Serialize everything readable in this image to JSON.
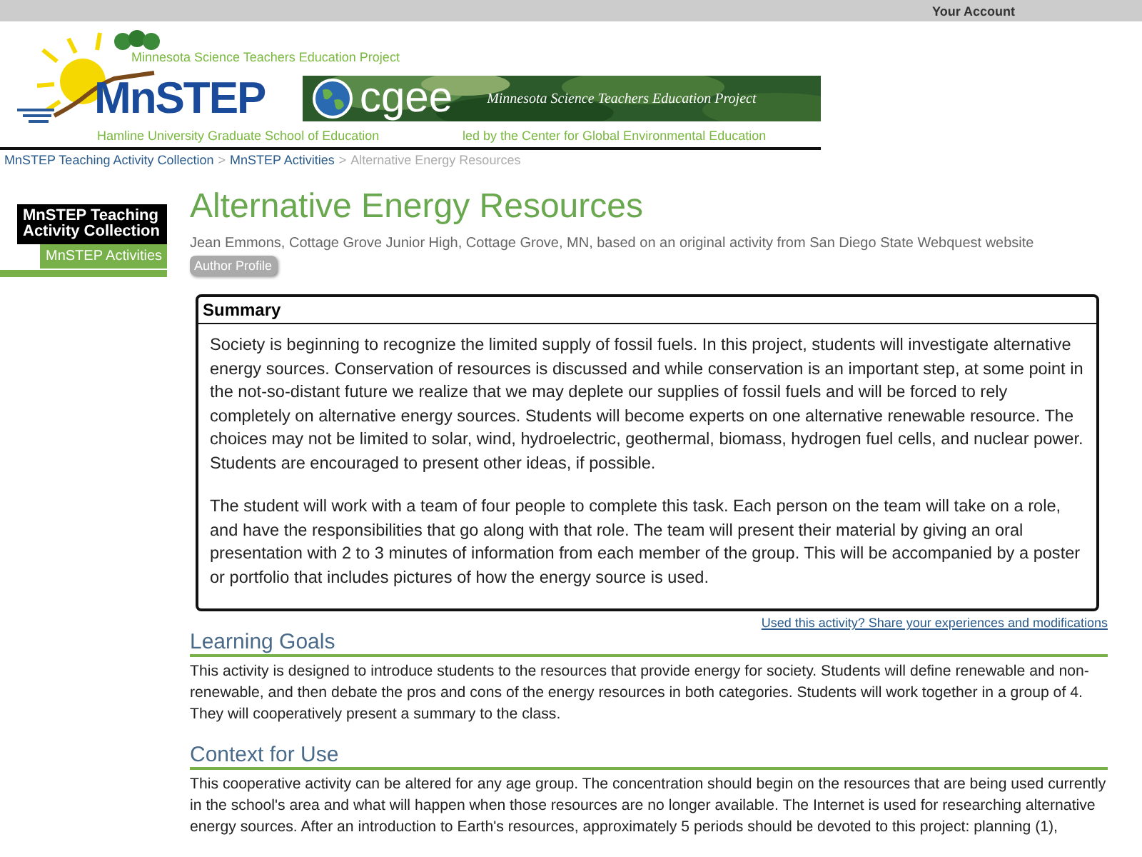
{
  "top_bar": {
    "account_link": "Your Account"
  },
  "banner": {
    "project_line": "Minnesota Science Teachers Education Project",
    "logo": "MnSTEP",
    "university": "Hamline University Graduate School of Education",
    "cgee_logo": "cgee",
    "cgee_tagline": "Minnesota Science Teachers Education Project",
    "led_by": "led by the Center for Global Environmental Education"
  },
  "breadcrumb": [
    {
      "label": "MnSTEP Teaching Activity Collection",
      "kind": "link"
    },
    {
      "separator": ">",
      "label": "MnSTEP Activities",
      "kind": "link"
    },
    {
      "separator": ">",
      "label": "Alternative Energy Resources",
      "kind": "current"
    }
  ],
  "sidebar": {
    "collection": "MnSTEP Teaching Activity Collection",
    "items": [
      {
        "label": "MnSTEP Activities",
        "selected": true
      }
    ]
  },
  "page": {
    "title": "Alternative Energy Resources",
    "author": "Jean Emmons, Cottage Grove Junior High, Cottage Grove, MN, based on an original activity from San Diego State Webquest website",
    "author_button": "Author Profile"
  },
  "summary": {
    "heading": "Summary",
    "paragraphs": [
      "Society is beginning to recognize the limited supply of fossil fuels. In this project, students will investigate alternative energy sources. Conservation of resources is discussed and while conservation is an important step, at some point in the not-so-distant future we realize that we may deplete our supplies of fossil fuels and will be forced to rely completely on alternative energy sources. Students will become experts on one alternative renewable resource. The choices may not be limited to solar, wind, hydroelectric, geothermal, biomass, hydrogen fuel cells, and nuclear power. Students are encouraged to present other ideas, if possible.",
      "The student will work with a team of four people to complete this task. Each person on the team will take on a role, and have the responsibilities that go along with that role. The team will present their material by giving an oral presentation with 2 to 3 minutes of information from each member of the group. This will be accompanied by a poster or portfolio that includes pictures of how the energy source is used."
    ]
  },
  "share_link": "Used this activity? Share your experiences and modifications",
  "sections": [
    {
      "heading": "Learning Goals",
      "text": "This activity is designed to introduce students to the resources that provide energy for society. Students will define renewable and non-renewable, and then debate the pros and cons of the energy resources in both categories. Students will work together in a group of 4. They will cooperatively present a summary to the class."
    },
    {
      "heading": "Context for Use",
      "text": "This cooperative activity can be altered for any age group. The concentration should begin on the resources that are being used currently in the school's area and what will happen when those resources are no longer available. The Internet is used for researching alternative energy sources. After an introduction to Earth's resources, approximately 5 periods should be devoted to this project: planning (1),"
    }
  ]
}
